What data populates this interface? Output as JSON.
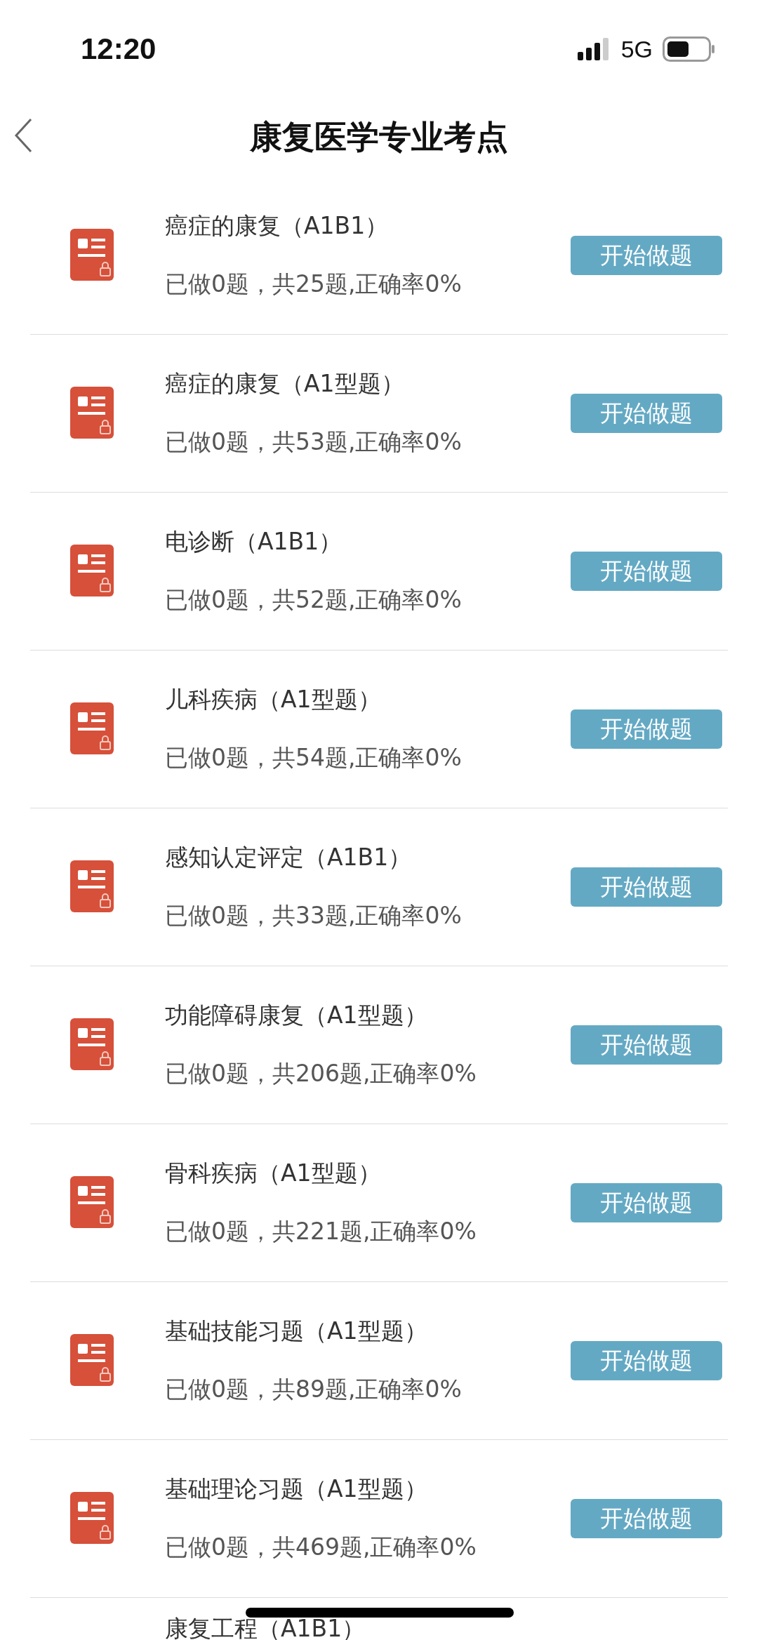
{
  "status_bar": {
    "time": "12:20",
    "network": "5G"
  },
  "header": {
    "title": "康复医学专业考点"
  },
  "items": [
    {
      "title": "癌症的康复（A1B1）",
      "progress": "已做0题，共25题,正确率0%",
      "button": "开始做题"
    },
    {
      "title": "癌症的康复（A1型题）",
      "progress": "已做0题，共53题,正确率0%",
      "button": "开始做题"
    },
    {
      "title": "电诊断（A1B1）",
      "progress": "已做0题，共52题,正确率0%",
      "button": "开始做题"
    },
    {
      "title": "儿科疾病（A1型题）",
      "progress": "已做0题，共54题,正确率0%",
      "button": "开始做题"
    },
    {
      "title": "感知认定评定（A1B1）",
      "progress": "已做0题，共33题,正确率0%",
      "button": "开始做题"
    },
    {
      "title": "功能障碍康复（A1型题）",
      "progress": "已做0题，共206题,正确率0%",
      "button": "开始做题"
    },
    {
      "title": "骨科疾病（A1型题）",
      "progress": "已做0题，共221题,正确率0%",
      "button": "开始做题"
    },
    {
      "title": "基础技能习题（A1型题）",
      "progress": "已做0题，共89题,正确率0%",
      "button": "开始做题"
    },
    {
      "title": "基础理论习题（A1型题）",
      "progress": "已做0题，共469题,正确率0%",
      "button": "开始做题"
    }
  ],
  "partial_item": {
    "title": "康复工程（A1B1）"
  }
}
